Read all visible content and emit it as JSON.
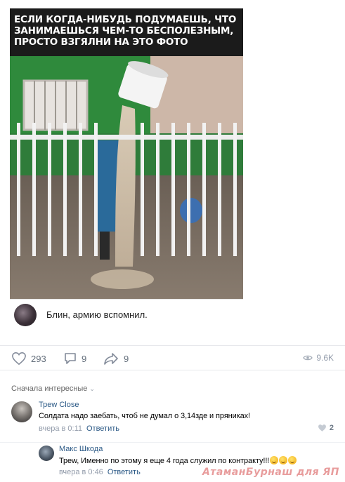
{
  "post": {
    "image": {
      "caption_lines": [
        "ЕСЛИ КОГДА-НИБУДЬ ПОДУМАЕШЬ, ЧТО",
        "ЗАНИМАЕШЬСЯ ЧЕМ-ТО БЕСПОЛЕЗНЫМ,",
        "ПРОСТО ВЗГЯЛНИ НА ЭТО ФОТО"
      ],
      "embedded_comment": "Блин, армию вспомнил."
    },
    "actions": {
      "likes": "293",
      "comments": "9",
      "shares": "9",
      "views": "9.6K"
    }
  },
  "comments_section": {
    "sort_label": "Сначала интересные",
    "comments": [
      {
        "author": "Трew Close",
        "text": "Солдата надо заебать, чтоб не думал о 3,14зде и пряниках!",
        "time": "вчера в 0:11",
        "reply_label": "Ответить",
        "likes": "2"
      },
      {
        "author": "Макс Шкода",
        "text": "Трew, Именно по этому я еще 4 года служил по контракту!!!",
        "time": "вчера в 0:46",
        "reply_label": "Ответить"
      }
    ]
  },
  "watermark": "АтаманБурнаш для ЯП",
  "colors": {
    "link": "#2a5885",
    "meta": "#939cab",
    "divider": "#e7e8ec"
  }
}
